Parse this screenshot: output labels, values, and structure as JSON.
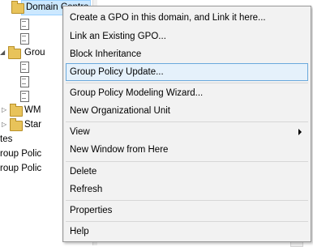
{
  "tree": {
    "selected_node": "Domain Contro",
    "items": [
      {
        "label": "Grou"
      },
      {
        "label": "WM"
      },
      {
        "label": "Star"
      },
      {
        "label": "tes"
      },
      {
        "label": "roup Polic"
      },
      {
        "label": "roup Polic"
      }
    ]
  },
  "context_menu": {
    "items": [
      {
        "label": "Create a GPO in this domain, and Link it here..."
      },
      {
        "label": "Link an Existing GPO..."
      },
      {
        "label": "Block Inheritance"
      },
      {
        "label": "Group Policy Update..."
      },
      {
        "label": "Group Policy Modeling Wizard..."
      },
      {
        "label": "New Organizational Unit"
      },
      {
        "label": "View"
      },
      {
        "label": "New Window from Here"
      },
      {
        "label": "Delete"
      },
      {
        "label": "Refresh"
      },
      {
        "label": "Properties"
      },
      {
        "label": "Help"
      }
    ],
    "highlighted_item": "Group Policy Update..."
  },
  "colors": {
    "menu_background": "#f2f2f2",
    "highlight_background": "#e5f1fb",
    "highlight_border": "#6aa9dc",
    "tree_selection": "#cce8ff"
  }
}
